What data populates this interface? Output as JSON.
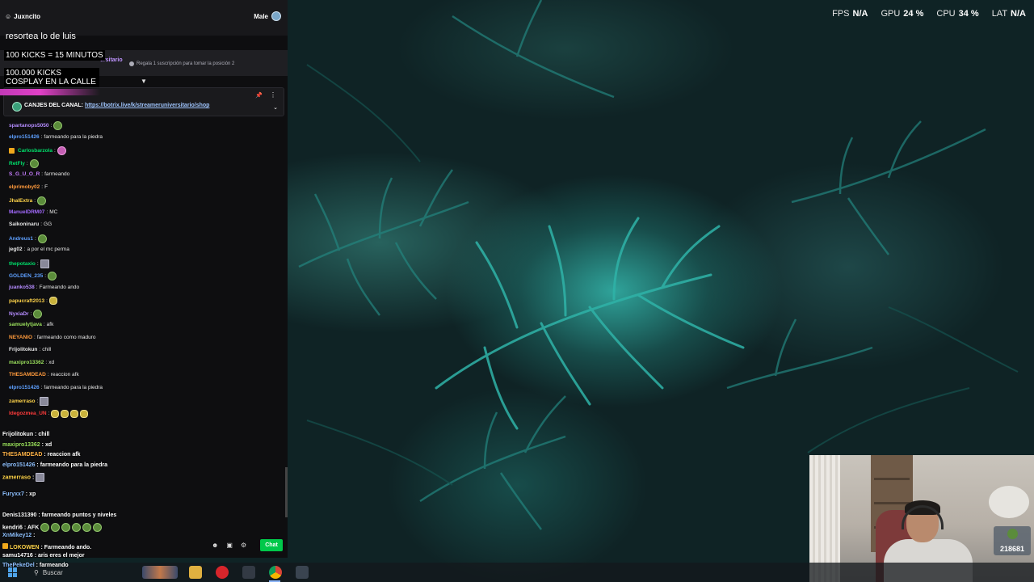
{
  "perf": {
    "fps_label": "FPS",
    "fps_value": "N/A",
    "gpu_label": "GPU",
    "gpu_value": "24 %",
    "cpu_label": "CPU",
    "cpu_value": "34 %",
    "lat_label": "LAT",
    "lat_value": "N/A"
  },
  "chat": {
    "header_user": "Juxncito",
    "header_right": "Male",
    "overlay_line1": "resortea lo de luis",
    "overlay_line2": "100 KICKS = 15 MINUTOS",
    "overlay_line3": "100.000 KICKS COSPLAY EN LA CALLE",
    "sub_channel": "ersitario",
    "sub_info": "Regala 1 suscripción para tomar la posición 2",
    "pinned_prefix": "CANJES DEL CANAL:",
    "pinned_link": "https://botrix.live/k/streameruniversitario/shop",
    "messages": [
      {
        "user": "spartanops5050",
        "text": "",
        "color": "#b58cff",
        "emote": "green"
      },
      {
        "user": "elpro151426",
        "text": "farmeando para la piedra",
        "color": "#5ea0ff",
        "emote": ""
      },
      {
        "user": "Carlosbarzola",
        "text": "",
        "color": "#00e06b",
        "emote": "pink"
      },
      {
        "user": "RetFly",
        "text": "",
        "color": "#00e06b",
        "emote": "green"
      },
      {
        "user": "S_G_U_O_R",
        "text": "farmeando",
        "color": "#c77dff",
        "emote": ""
      },
      {
        "user": "elprimoby02",
        "text": "F",
        "color": "#ff9a3c",
        "emote": ""
      },
      {
        "user": "JhalExtra",
        "text": "",
        "color": "#ffd44a",
        "emote": "green"
      },
      {
        "user": "ManuelDRM07",
        "text": "MC",
        "color": "#a46bff",
        "emote": ""
      },
      {
        "user": "Saikoninaru",
        "text": "GG",
        "color": "#e6e6e6",
        "emote": ""
      },
      {
        "user": "Andreus1",
        "text": "",
        "color": "#5ea0ff",
        "emote": "green"
      },
      {
        "user": "jeg02",
        "text": "a por el mc perma",
        "color": "#e6e6e6",
        "emote": ""
      },
      {
        "user": "thepotaxio",
        "text": "",
        "color": "#00e06b",
        "emote": "sq"
      },
      {
        "user": "GOLDEN_235",
        "text": "",
        "color": "#5ea0ff",
        "emote": "green"
      },
      {
        "user": "juanko538",
        "text": "Farmeando ando",
        "color": "#b58cff",
        "emote": ""
      },
      {
        "user": "papucraft2013",
        "text": "",
        "color": "#ffd44a",
        "emote": "yel"
      },
      {
        "user": "NyxiaDr",
        "text": "",
        "color": "#b58cff",
        "emote": "green"
      },
      {
        "user": "samuelytjava",
        "text": "afk",
        "color": "#9be15d",
        "emote": ""
      },
      {
        "user": "NEYANIO",
        "text": "farmeando como maduro",
        "color": "#ff9a3c",
        "emote": ""
      },
      {
        "user": "Frijolitokun",
        "text": "chill",
        "color": "#e6e6e6",
        "emote": ""
      },
      {
        "user": "maxipro13362",
        "text": "xd",
        "color": "#9be15d",
        "emote": ""
      },
      {
        "user": "THESAMDEAD",
        "text": "reaccion afk",
        "color": "#ff9a3c",
        "emote": ""
      },
      {
        "user": "elpro151426",
        "text": "farmeando para la piedra",
        "color": "#5ea0ff",
        "emote": ""
      },
      {
        "user": "zamerraso",
        "text": "",
        "color": "#ffd44a",
        "emote": "sq"
      },
      {
        "user": "ldegozmea_UN",
        "text": "",
        "color": "#ff3b3b",
        "emote": "yel4"
      }
    ],
    "overlay_messages": [
      {
        "user": "Frijolitokun",
        "text": "chill",
        "color": "#ffffff"
      },
      {
        "user": "maxipro13362",
        "text": "xd",
        "color": "#9be15d"
      },
      {
        "user": "THESAMDEAD",
        "text": "reaccion afk",
        "color": "#ffb347"
      },
      {
        "user": "elpro151426",
        "text": "farmeando para la piedra",
        "color": "#8fc1ff"
      },
      {
        "user": "zamerraso",
        "text": "",
        "color": "#ffd44a"
      },
      {
        "user": "Furyxx7",
        "text": "xp",
        "color": "#8fc1ff"
      },
      {
        "user": "Denis131390",
        "text": "farmeando puntos y niveles",
        "color": "#ffffff"
      },
      {
        "user": "kendri6",
        "text": "AFK",
        "color": "#ffffff"
      },
      {
        "user": "XnMikey12",
        "text": "",
        "color": "#8fc1ff"
      },
      {
        "user": "LOKOWEN",
        "text": "Farmeando ando.",
        "color": "#ffd44a"
      },
      {
        "user": "samu14716",
        "text": "aris eres el mejor",
        "color": "#ffffff"
      },
      {
        "user": "ThePekeDel",
        "text": "farmeando",
        "color": "#8fc1ff"
      }
    ],
    "chat_button": "Chat"
  },
  "webcam": {
    "counter": "218681"
  },
  "taskbar": {
    "search_placeholder": "Buscar"
  },
  "colors": {
    "accent_green": "#00c84a",
    "chat_bg": "#0e0e10"
  }
}
